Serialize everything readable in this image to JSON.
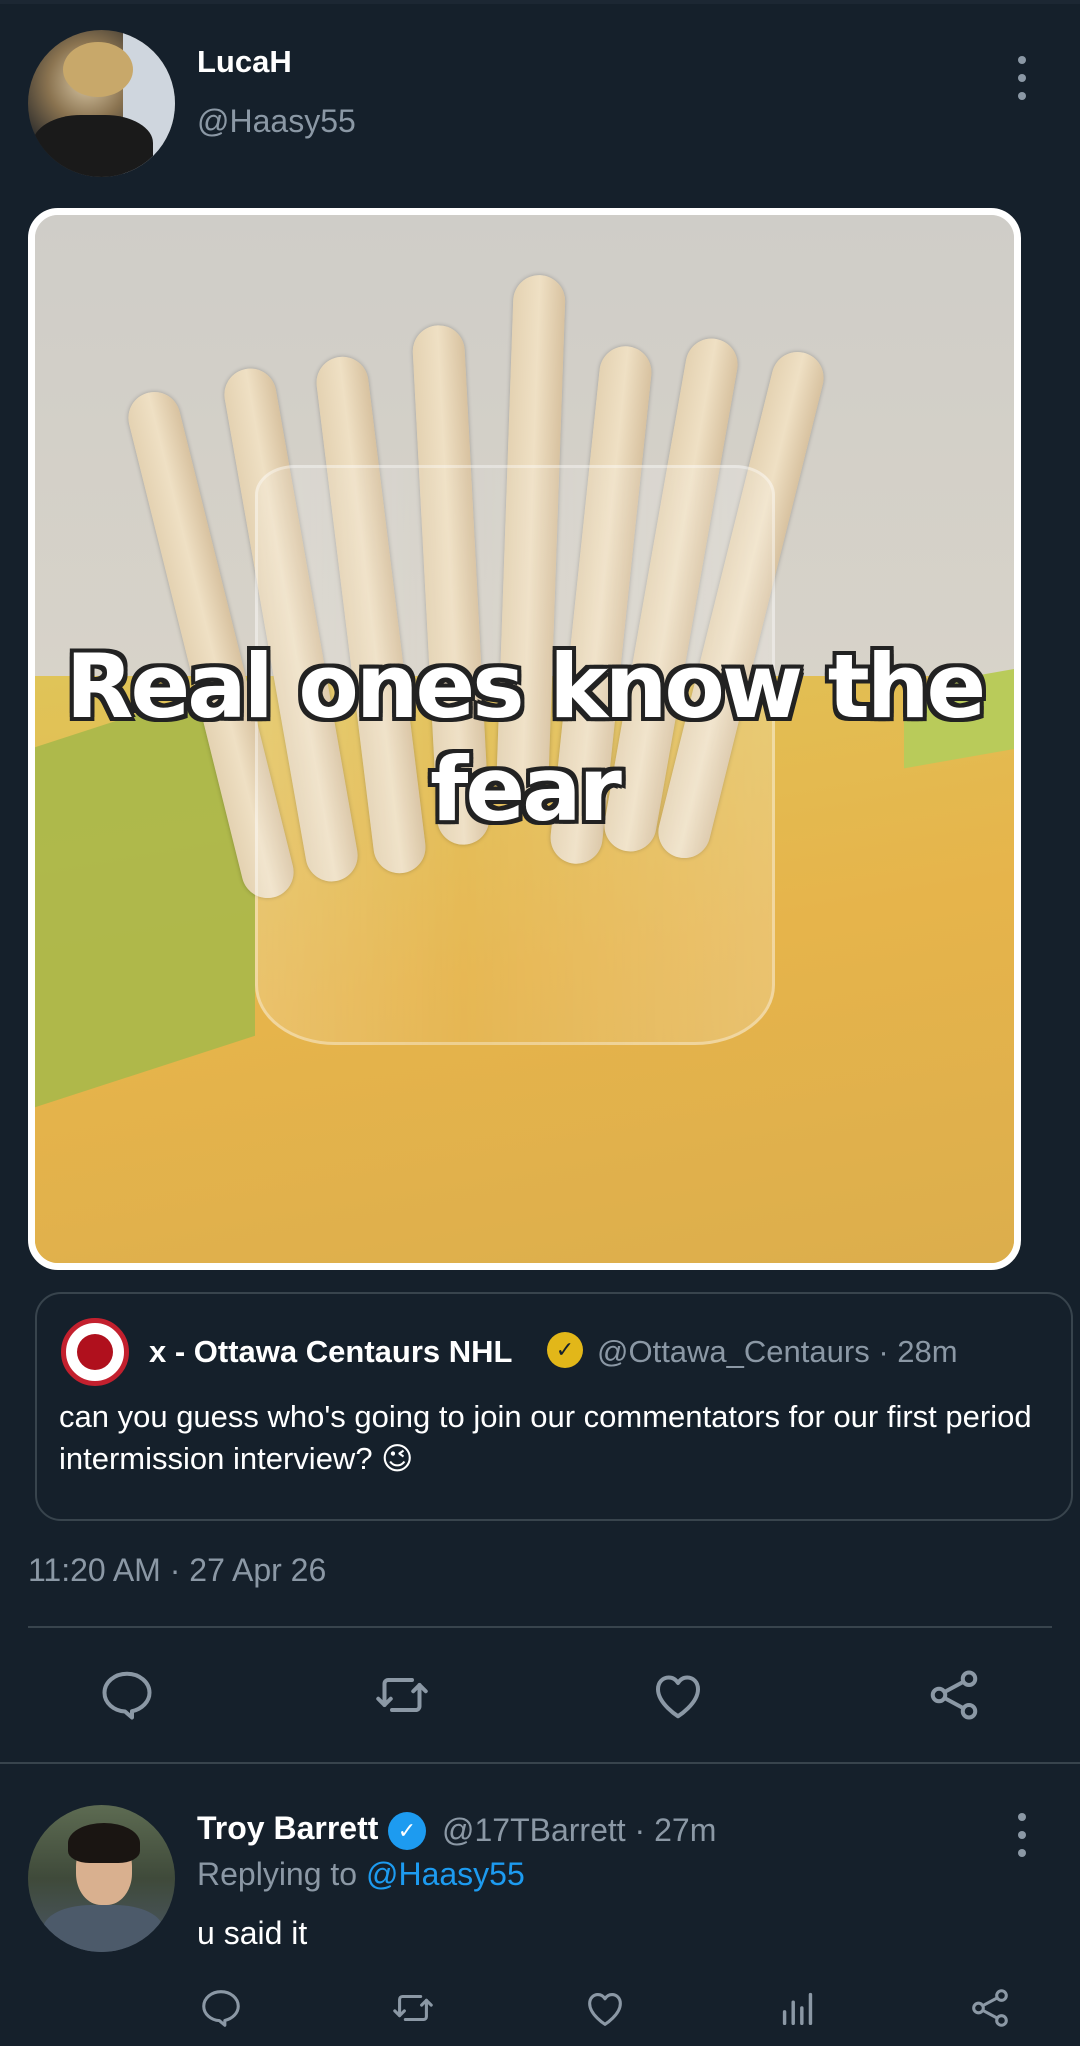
{
  "tweet": {
    "author_name": "LucaH",
    "author_handle": "@Haasy55",
    "media_caption": "Real ones know the fear",
    "timestamp": "11:20 AM · 27 Apr 26"
  },
  "quoted": {
    "name": "x - Ottawa Centaurs NHL",
    "meta": "@Ottawa_Centaurs · 28m",
    "text": "can you guess who's going to join our commentators for our first period intermission interview? 😉",
    "badge_color": "#e2b719"
  },
  "reply": {
    "name": "Troy Barrett",
    "meta": "@17TBarrett · 27m",
    "replying_prefix": "Replying to",
    "replying_mention": "@Haasy55",
    "text": "u said it",
    "badge_color": "#1d9bf0"
  },
  "icons": {
    "actions": [
      "reply-icon",
      "retweet-icon",
      "like-icon",
      "share-icon"
    ],
    "reply_actions": [
      "reply-icon",
      "retweet-icon",
      "like-icon",
      "analytics-icon",
      "share-icon"
    ]
  },
  "colors": {
    "background": "#15202b",
    "secondary_text": "#8b98a5",
    "accent": "#1d9bf0",
    "divider": "#38444d"
  }
}
